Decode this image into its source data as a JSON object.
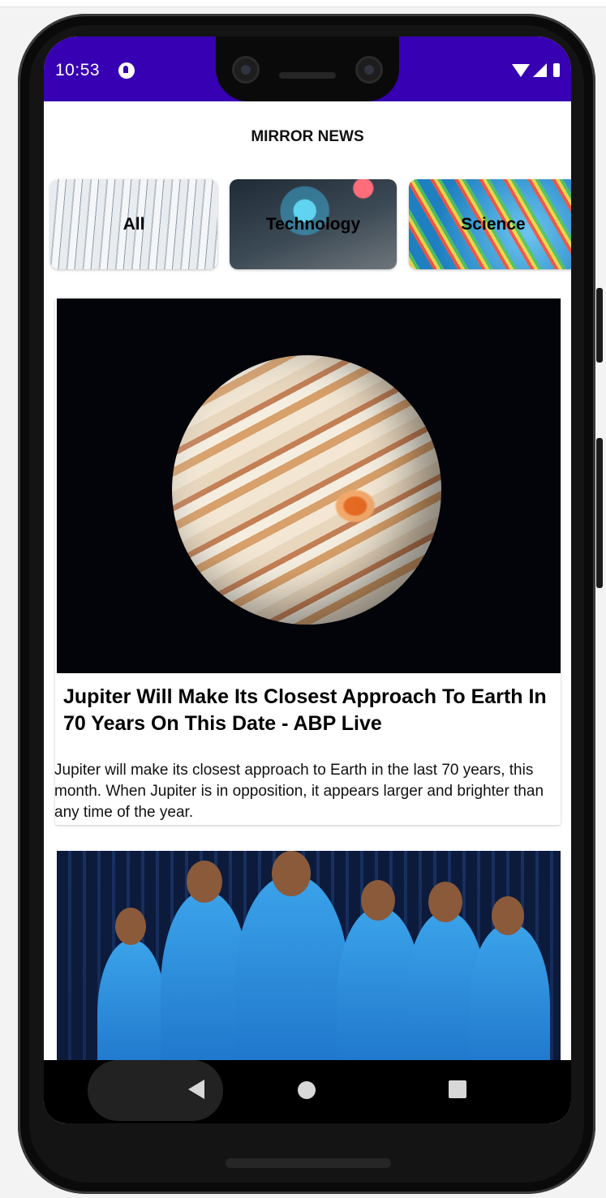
{
  "status_bar": {
    "time": "10:53",
    "app_icon": "notification-app-icon",
    "icons": [
      "wifi-icon",
      "signal-icon",
      "battery-icon"
    ],
    "color": "#3700b3"
  },
  "header": {
    "title": "MIRROR NEWS"
  },
  "categories": [
    {
      "label": "All"
    },
    {
      "label": "Technology"
    },
    {
      "label": "Science"
    }
  ],
  "articles": [
    {
      "image": "jupiter-image",
      "title": "Jupiter Will Make Its Closest Approach To Earth In 70 Years On This Date - ABP Live",
      "description": "Jupiter will make its closest approach to Earth in the last 70 years, this month. When Jupiter is in opposition, it appears larger and brighter than any time of the year."
    },
    {
      "image": "cricket-team-image"
    }
  ],
  "nav_bar": {
    "buttons": [
      "back-icon",
      "home-icon",
      "recents-icon"
    ]
  }
}
